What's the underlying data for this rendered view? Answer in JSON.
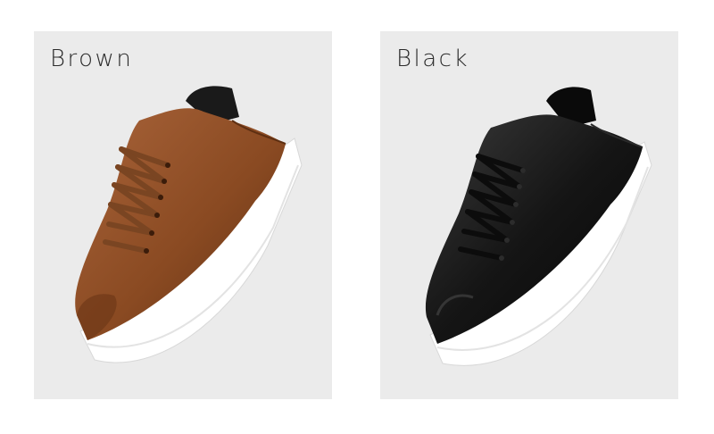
{
  "variants": [
    {
      "label": "Brown",
      "upper_color": "#8a4a22",
      "upper_highlight": "#a9643a",
      "upper_shadow": "#5e2f12",
      "lace_color": "#7a4522",
      "collar_color": "#1a1a1a",
      "sole_color": "#ffffff"
    },
    {
      "label": "Black",
      "upper_color": "#151515",
      "upper_highlight": "#3a3a3a",
      "upper_shadow": "#050505",
      "lace_color": "#0c0c0c",
      "collar_color": "#0a0a0a",
      "sole_color": "#ffffff"
    }
  ]
}
